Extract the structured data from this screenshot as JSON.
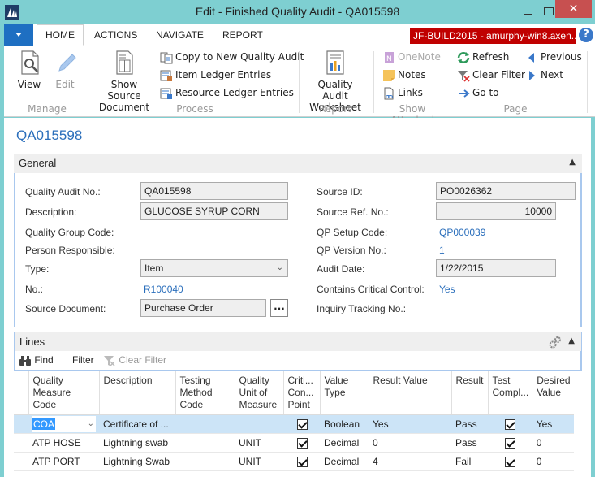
{
  "window": {
    "title": "Edit - Finished Quality Audit - QA015598",
    "close_glyph": "✕"
  },
  "ribbon_tabs": [
    {
      "label": "HOME",
      "active": true
    },
    {
      "label": "ACTIONS",
      "active": false
    },
    {
      "label": "NAVIGATE",
      "active": false
    },
    {
      "label": "REPORT",
      "active": false
    }
  ],
  "server_badge": "JF-BUILD2015 - amurphy-win8.axen...",
  "help_glyph": "?",
  "ribbon": {
    "manage": {
      "label": "Manage",
      "view": "View",
      "edit": "Edit"
    },
    "process": {
      "label": "Process",
      "show_source_line1": "Show Source",
      "show_source_line2": "Document",
      "copy": "Copy to New Quality Audit",
      "item_ledger": "Item Ledger Entries",
      "resource_ledger": "Resource Ledger Entries"
    },
    "report": {
      "label": "Report",
      "worksheet_line1": "Quality Audit",
      "worksheet_line2": "Worksheet"
    },
    "show_attached": {
      "label": "Show Attached",
      "onenote": "OneNote",
      "notes": "Notes",
      "links": "Links"
    },
    "page": {
      "label": "Page",
      "refresh": "Refresh",
      "clear_filter": "Clear Filter",
      "go_to": "Go to",
      "previous": "Previous",
      "next": "Next"
    }
  },
  "record_title": "QA015598",
  "general": {
    "title": "General",
    "left": {
      "quality_audit_no": {
        "label": "Quality Audit No.:",
        "value": "QA015598"
      },
      "description": {
        "label": "Description:",
        "value": "GLUCOSE SYRUP CORN"
      },
      "quality_group_code": {
        "label": "Quality Group Code:",
        "value": ""
      },
      "person_responsible": {
        "label": "Person Responsible:",
        "value": ""
      },
      "type": {
        "label": "Type:",
        "value": "Item"
      },
      "no": {
        "label": "No.:",
        "value": "R100040"
      },
      "source_document": {
        "label": "Source Document:",
        "value": "Purchase Order",
        "button": "..."
      }
    },
    "right": {
      "source_id": {
        "label": "Source ID:",
        "value": "PO0026362"
      },
      "source_ref_no": {
        "label": "Source Ref. No.:",
        "value": "10000"
      },
      "qp_setup_code": {
        "label": "QP Setup Code:",
        "value": "QP000039"
      },
      "qp_version_no": {
        "label": "QP Version No.:",
        "value": "1"
      },
      "audit_date": {
        "label": "Audit Date:",
        "value": "1/22/2015"
      },
      "contains_critical_control": {
        "label": "Contains Critical Control:",
        "value": "Yes"
      },
      "inquiry_tracking_no": {
        "label": "Inquiry Tracking No.:",
        "value": ""
      }
    }
  },
  "lines": {
    "title": "Lines",
    "toolbar": {
      "find": "Find",
      "filter": "Filter",
      "clear_filter": "Clear Filter"
    },
    "columns": [
      "Quality Measure Code",
      "Description",
      "Testing Method Code",
      "Quality Unit of Measure",
      "Criti... Con... Point",
      "Value Type",
      "Result Value",
      "Result",
      "Test Compl...",
      "Desired Value"
    ],
    "rows": [
      {
        "code": "COA",
        "description": "Certificate of ...",
        "testing_method": "",
        "uom": "",
        "ccp": true,
        "value_type": "Boolean",
        "result_value": "Yes",
        "result": "Pass",
        "test_complete": true,
        "desired_value": "Yes",
        "selected": true
      },
      {
        "code": "ATP HOSE",
        "description": "Lightning swab",
        "testing_method": "",
        "uom": "UNIT",
        "ccp": true,
        "value_type": "Decimal",
        "result_value": "0",
        "result": "Pass",
        "test_complete": true,
        "desired_value": "0",
        "selected": false
      },
      {
        "code": "ATP PORT",
        "description": "Lightning Swab",
        "testing_method": "",
        "uom": "UNIT",
        "ccp": true,
        "value_type": "Decimal",
        "result_value": "4",
        "result": "Fail",
        "test_complete": true,
        "desired_value": "0",
        "selected": false
      }
    ]
  }
}
